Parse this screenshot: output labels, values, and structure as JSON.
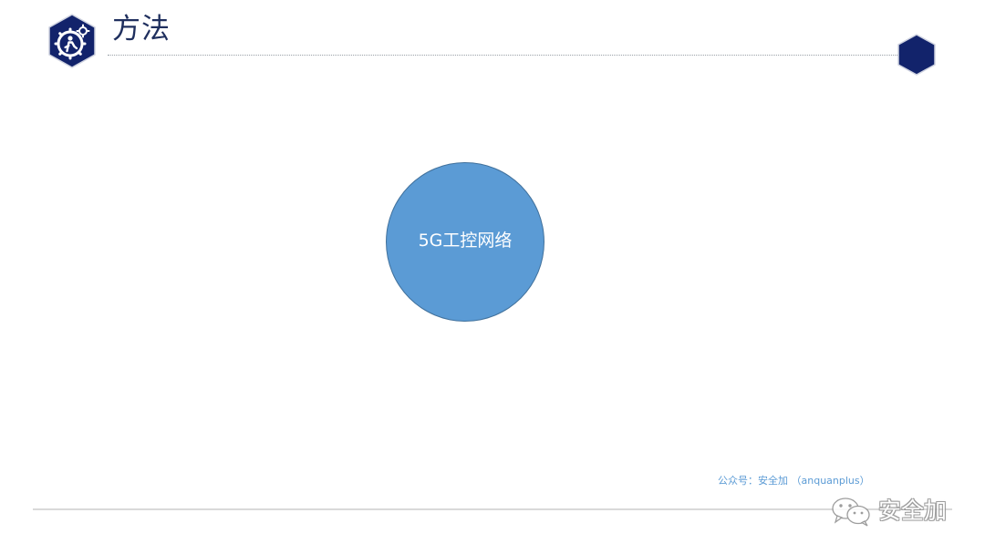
{
  "slide": {
    "title": "方法",
    "center_node": {
      "label": "5G工控网络"
    },
    "credit": "公众号：安全加 （anquanplus）",
    "watermark": {
      "icon": "wechat-icon",
      "text": "安全加"
    }
  },
  "colors": {
    "title": "#1f2f5e",
    "hex_dark": "#12236b",
    "circle_fill": "#5b9bd5",
    "circle_border": "#41719c",
    "credit": "#5b9bd5"
  },
  "icons": {
    "logo": "gear-person-hex-icon",
    "corner": "hexagon-icon"
  }
}
